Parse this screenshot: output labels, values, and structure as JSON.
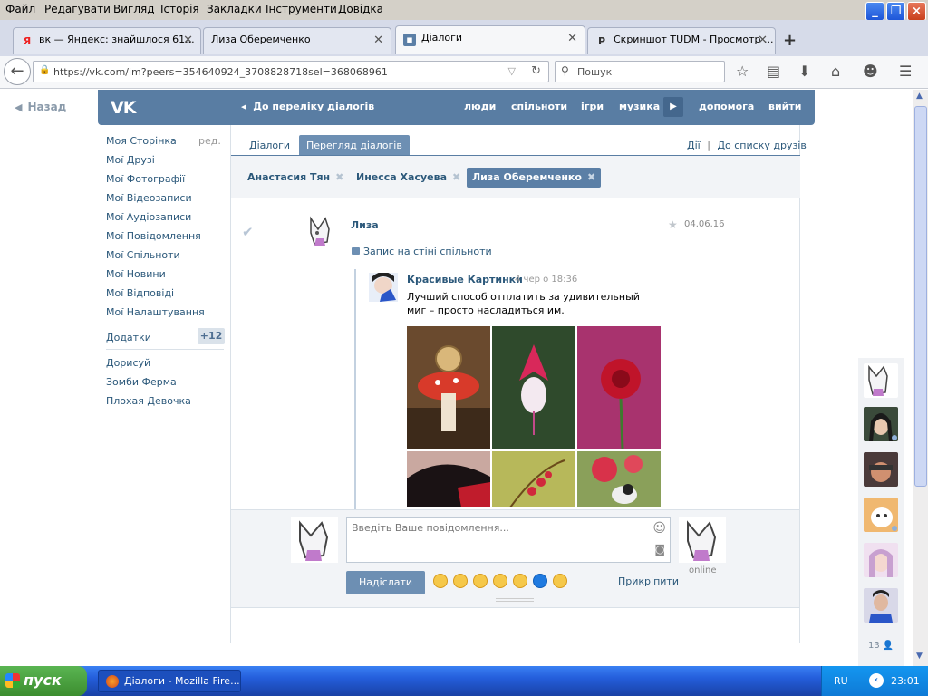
{
  "menubar": {
    "items": [
      "Файл",
      "Редагувати",
      "Вигляд",
      "Історія",
      "Закладки",
      "Інструменти",
      "Довідка"
    ]
  },
  "tabs": [
    {
      "label": "вк — Яндекс: знайшлося 61...",
      "icon": "yandex-icon"
    },
    {
      "label": "Лиза Оберемченко",
      "icon": ""
    },
    {
      "label": "Діалоги",
      "icon": "vk-icon"
    },
    {
      "label": "Скриншот TUDM - Просмотр ...",
      "icon": "p-icon"
    }
  ],
  "urlbar": {
    "url": "https://vk.com/im?peers=354640924_3708828718sel=368068961",
    "search_placeholder": "Пошук"
  },
  "back": {
    "label": "Назад"
  },
  "vk_header": {
    "logo": "VK",
    "back_to_dialogs": "До переліку діалогів",
    "links": [
      "люди",
      "спільноти",
      "ігри",
      "музика",
      "допомога",
      "вийти"
    ]
  },
  "left_nav": {
    "items": [
      "Моя Сторінка",
      "Мої Друзі",
      "Мої Фотографії",
      "Мої Відеозаписи",
      "Мої Аудіозаписи",
      "Мої Повідомлення",
      "Мої Спільноти",
      "Мої Новини",
      "Мої Відповіді",
      "Мої Налаштування"
    ],
    "edit_label": "ред.",
    "apps_label": "Додатки",
    "apps_count": "+12",
    "apps": [
      "Дорисуй",
      "Зомби Ферма",
      "Плохая Девочка"
    ]
  },
  "content_tabs": {
    "dialogs": "Діалоги",
    "view": "Перегляд діалогів",
    "actions": "Дії",
    "sep": "|",
    "to_friends": "До списку друзів"
  },
  "chips": [
    {
      "name": "Анастасия Тян",
      "selected": false
    },
    {
      "name": "Инесса Хасуева",
      "selected": false
    },
    {
      "name": "Лиза Оберемченко",
      "selected": true
    }
  ],
  "message": {
    "sender": "Лиза",
    "date": "04.06.16",
    "attachment_label": "Запис на стіні спільноти",
    "post": {
      "author": "Красивые Картинки",
      "time": "4 чер о 18:36",
      "text": "Лучший способ отплатить за удивительный миг – просто насладиться им."
    }
  },
  "composer": {
    "placeholder": "Введіть Ваше повідомлення...",
    "send": "Надіслати",
    "attach": "Прикріпити",
    "online": "online"
  },
  "rightbar": {
    "count": "13"
  },
  "taskbar": {
    "start": "пуск",
    "task": "Діалоги - Mozilla Fire...",
    "lang": "RU",
    "time": "23:01"
  }
}
